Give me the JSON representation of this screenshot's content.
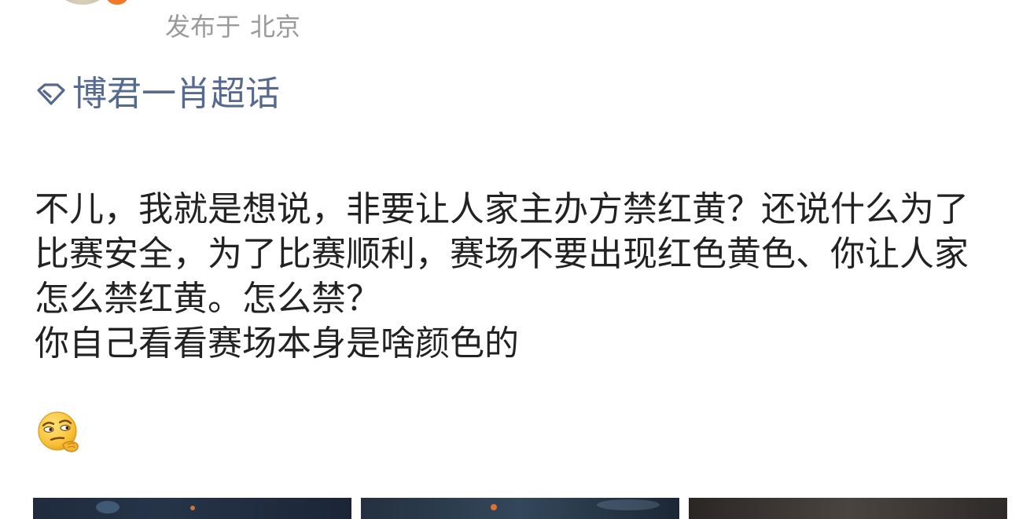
{
  "post": {
    "meta": {
      "published_prefix": "发布于",
      "location": "北京"
    },
    "topic": {
      "icon": "diamond-icon",
      "label": "博君一肖超话",
      "color": "#56698f"
    },
    "paragraphs": [
      "不儿，我就是想说，非要让人家主办方禁红黄？还说什么为了比赛安全，为了比赛顺利，赛场不要出现红色黄色、你让人家怎么禁红黄。怎么禁？",
      "你自己看看赛场本身是啥颜色的"
    ],
    "emoji": "thinking-smirk-emoji"
  },
  "colors": {
    "meta_text": "#9a9a9a",
    "body_text": "#222222",
    "badge": "#f07a2a"
  }
}
